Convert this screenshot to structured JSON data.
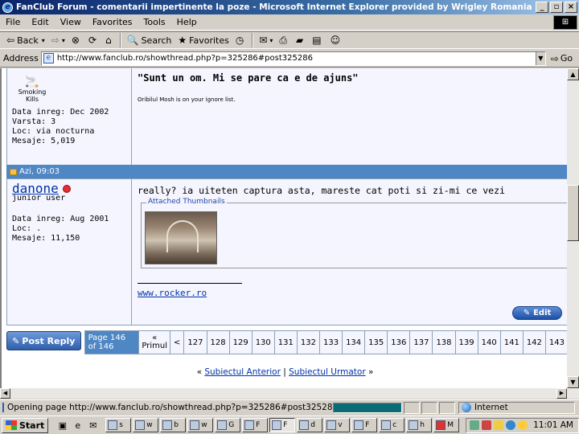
{
  "window": {
    "title": "FanClub Forum - comentarii impertinente la poze - Microsoft Internet Explorer provided by Wrigley Romania",
    "buttons": [
      "_",
      "×"
    ]
  },
  "menu": [
    "File",
    "Edit",
    "View",
    "Favorites",
    "Tools",
    "Help"
  ],
  "toolbar": {
    "back": "Back",
    "search": "Search",
    "favorites": "Favorites"
  },
  "address": {
    "label": "Address",
    "url": "http://www.fanclub.ro/showthread.php?p=325286#post325286",
    "go": "Go"
  },
  "post1": {
    "smoking_label": "Smoking Kills",
    "info": [
      "Data inreg: Dec 2002",
      "Varsta: 3",
      "Loc: via nocturna",
      "Mesaje: 5,019"
    ],
    "quote_title": "\"Sunt un om. Mi se pare ca e de ajuns\"",
    "ignore_notice": "Oribilul Mosh is on your ignore list."
  },
  "post2": {
    "header_time": "Azi, 09:03",
    "username": "danone",
    "rank": "junior user",
    "info": [
      "Data inreg: Aug 2001",
      "Loc: .",
      "Mesaje: 11,150"
    ],
    "message": "really? ia uiteten captura asta, mareste cat poti si zi-mi ce vezi",
    "attachments_legend": "Attached Thumbnails",
    "signature": "www.rocker.ro",
    "edit_label": "Edit"
  },
  "pager": {
    "post_reply": "Post Reply",
    "page_info": "Page 146 of 146",
    "first_arrow": "«",
    "first_label": "Primul",
    "prev": "<",
    "pages": [
      "127",
      "128",
      "129",
      "130",
      "131",
      "132",
      "133",
      "134",
      "135",
      "136",
      "137",
      "138",
      "139",
      "140",
      "141",
      "142",
      "143"
    ]
  },
  "thread_nav": {
    "prev_link": "Subiectul Anterior",
    "next_link": "Subiectul Urmator",
    "sep": "|",
    "left_quote": "«",
    "right_quote": "»"
  },
  "status": {
    "text": "Opening page http://www.fanclub.ro/showthread.php?p=325286#post325286...",
    "zone": "Internet"
  },
  "taskbar": {
    "start": "Start",
    "tasks": [
      "s",
      "w",
      "b",
      "w",
      "G",
      "F",
      "F",
      "d",
      "v",
      "F",
      "c",
      "h",
      "M"
    ],
    "clock": "11:01 AM"
  }
}
